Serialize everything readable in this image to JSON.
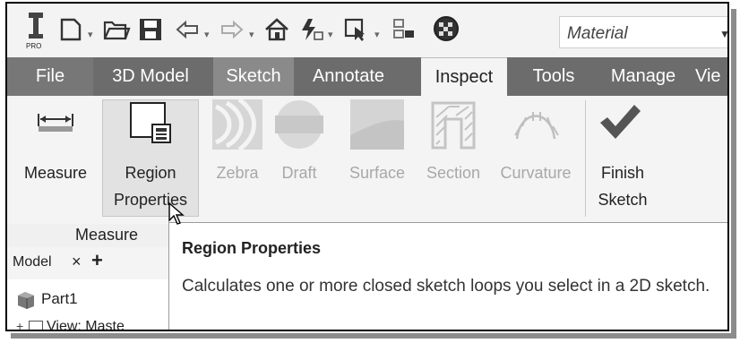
{
  "qat": {
    "app_logo_text": "PRO",
    "material_value": "Material"
  },
  "tabs": [
    {
      "label": "File"
    },
    {
      "label": "3D Model"
    },
    {
      "label": "Sketch"
    },
    {
      "label": "Annotate"
    },
    {
      "label": "Inspect"
    },
    {
      "label": "Tools"
    },
    {
      "label": "Manage"
    },
    {
      "label": "Vie"
    }
  ],
  "ribbon": {
    "measure": {
      "line1": "Measure"
    },
    "region_properties": {
      "line1": "Region",
      "line2": "Properties"
    },
    "zebra": {
      "line1": "Zebra"
    },
    "draft": {
      "line1": "Draft"
    },
    "surface": {
      "line1": "Surface"
    },
    "section": {
      "line1": "Section"
    },
    "curvature": {
      "line1": "Curvature"
    },
    "finish_sketch": {
      "line1": "Finish",
      "line2": "Sketch"
    },
    "panel_label": "Measure"
  },
  "browser": {
    "tab_label": "Model",
    "close_glyph": "×",
    "add_glyph": "+",
    "part_name": "Part1",
    "view_label": "View: Maste"
  },
  "tooltip": {
    "title": "Region Properties",
    "body": "Calculates one or more closed sketch loops you select in a 2D sketch."
  },
  "colors": {
    "tab_bar": "#6c6c6c",
    "active_tab": "#f4f4f4",
    "check": "#555555"
  }
}
